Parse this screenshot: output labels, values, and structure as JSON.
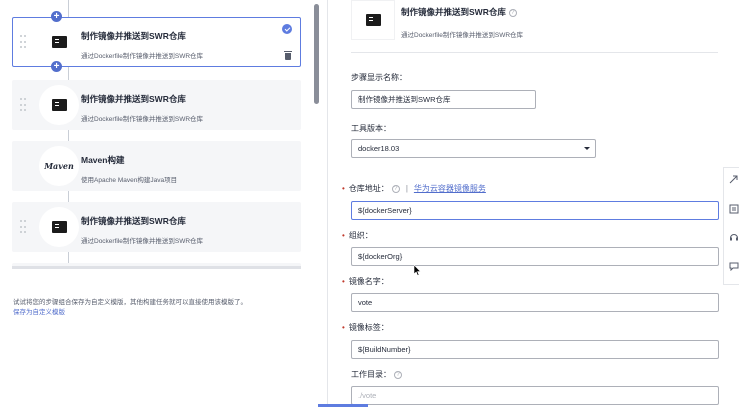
{
  "steps": [
    {
      "title": "制作镜像并推送到SWR仓库",
      "desc": "通过Dockerfile制作镜像并推送到SWR仓库",
      "icon": "terminal-icon",
      "selected": true
    },
    {
      "title": "制作镜像并推送到SWR仓库",
      "desc": "通过Dockerfile制作镜像并推送到SWR仓库",
      "icon": "terminal-icon",
      "selected": false
    },
    {
      "title": "Maven构建",
      "desc": "使用Apache Maven构建Java项目",
      "icon": "maven-icon",
      "logo_text": "Maven",
      "selected": false
    },
    {
      "title": "制作镜像并推送到SWR仓库",
      "desc": "通过Dockerfile制作镜像并推送到SWR仓库",
      "icon": "terminal-icon",
      "selected": false
    }
  ],
  "left_footer": {
    "text": "试试将您的步骤组合保存为自定义模版，其他构建任务就可以直接使用该模版了。",
    "link": "保存为自定义模版"
  },
  "detail": {
    "title": "制作镜像并推送到SWR仓库",
    "desc": "通过Dockerfile制作镜像并推送到SWR仓库",
    "help": "?"
  },
  "form": {
    "step_name_label": "步骤显示名称：",
    "step_name_value": "制作镜像并推送到SWR仓库",
    "tool_version_label": "工具版本：",
    "tool_version_value": "docker18.03",
    "repo_label": "仓库地址：",
    "repo_link": "华为云容器镜像服务",
    "repo_separator": "|",
    "repo_value": "${dockerServer}",
    "org_label": "组织：",
    "org_value": "${dockerOrg}",
    "image_name_label": "镜像名字：",
    "image_name_value": "vote",
    "image_tag_label": "镜像标签：",
    "image_tag_value": "${BuildNumber}",
    "workdir_label": "工作目录：",
    "workdir_value": "./vote",
    "required_mark": "•"
  },
  "colors": {
    "accent": "#5e7ce0",
    "link": "#526ecc",
    "required": "#c0392b",
    "card_bg": "#f5f6f8"
  }
}
